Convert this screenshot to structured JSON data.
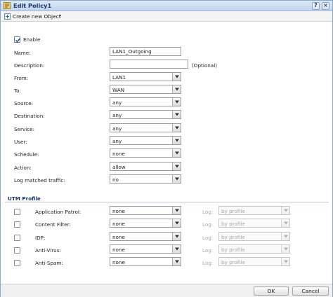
{
  "window": {
    "title": "Edit Policy1"
  },
  "toolbar": {
    "create_label": "Create new Object",
    "caret": "▾"
  },
  "form": {
    "enable_label": "Enable",
    "enable_checked": true,
    "name_label": "Name:",
    "name_value": "LAN1_Outgoing",
    "description_label": "Description:",
    "description_value": "",
    "optional_hint": "(Optional)",
    "selects": [
      {
        "label": "From:",
        "value": "LAN1"
      },
      {
        "label": "To:",
        "value": "WAN"
      },
      {
        "label": "Source:",
        "value": "any"
      },
      {
        "label": "Destination:",
        "value": "any"
      },
      {
        "label": "Service:",
        "value": "any"
      },
      {
        "label": "User:",
        "value": "any"
      },
      {
        "label": "Schedule:",
        "value": "none"
      },
      {
        "label": "Action:",
        "value": "allow"
      },
      {
        "label": "Log matched traffic:",
        "value": "no"
      }
    ]
  },
  "utm": {
    "section_title": "UTM Profile",
    "rows": [
      {
        "label": "Application Patrol:",
        "profile": "none",
        "log_label": "Log:",
        "log_value": "by profile",
        "checked": false
      },
      {
        "label": "Content Filter:",
        "profile": "none",
        "log_label": "Log:",
        "log_value": "by profile",
        "checked": false
      },
      {
        "label": "IDP:",
        "profile": "none",
        "log_label": "Log:",
        "log_value": "by profile",
        "checked": false
      },
      {
        "label": "Anti-Virus:",
        "profile": "none",
        "log_label": "Log:",
        "log_value": "by profile",
        "checked": false
      },
      {
        "label": "Anti-Spam:",
        "profile": "none",
        "log_label": "Log:",
        "log_value": "by profile",
        "checked": false
      }
    ]
  },
  "footer": {
    "ok_label": "OK",
    "cancel_label": "Cancel"
  },
  "colors": {
    "title_text": "#15356b",
    "border": "#8aa6c8"
  }
}
